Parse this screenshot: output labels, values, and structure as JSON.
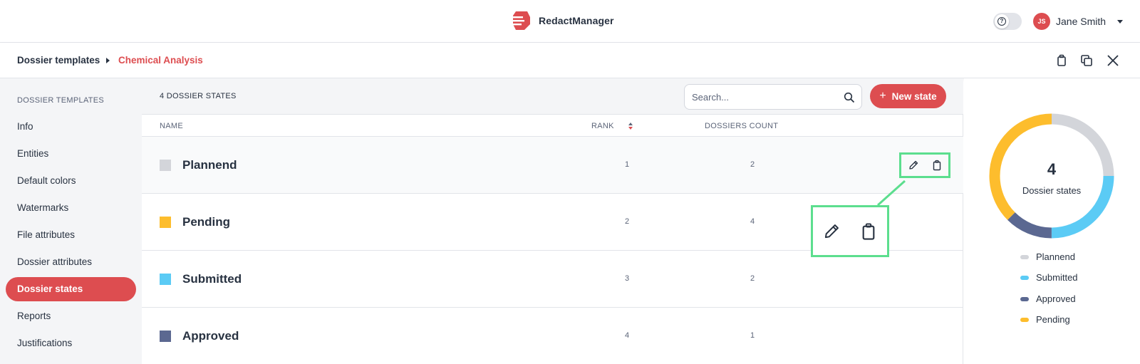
{
  "app": {
    "name": "RedactManager"
  },
  "user": {
    "initials": "JS",
    "name": "Jane Smith"
  },
  "breadcrumb": {
    "parent": "Dossier templates",
    "current": "Chemical Analysis"
  },
  "sidebar": {
    "heading": "DOSSIER TEMPLATES",
    "items": [
      {
        "label": "Info",
        "active": false
      },
      {
        "label": "Entities",
        "active": false
      },
      {
        "label": "Default colors",
        "active": false
      },
      {
        "label": "Watermarks",
        "active": false
      },
      {
        "label": "File attributes",
        "active": false
      },
      {
        "label": "Dossier attributes",
        "active": false
      },
      {
        "label": "Dossier states",
        "active": true
      },
      {
        "label": "Reports",
        "active": false
      },
      {
        "label": "Justifications",
        "active": false
      }
    ]
  },
  "main": {
    "count_label": "4 DOSSIER STATES",
    "search_placeholder": "Search...",
    "new_button": "New state",
    "columns": {
      "name": "NAME",
      "rank": "RANK",
      "count": "DOSSIERS COUNT"
    },
    "rows": [
      {
        "name": "Plannend",
        "rank": "1",
        "count": "2",
        "color": "#d3d5da"
      },
      {
        "name": "Pending",
        "rank": "2",
        "count": "4",
        "color": "#fdbd2d"
      },
      {
        "name": "Submitted",
        "rank": "3",
        "count": "2",
        "color": "#5bcbf5"
      },
      {
        "name": "Approved",
        "rank": "4",
        "count": "1",
        "color": "#5b6891"
      }
    ]
  },
  "summary": {
    "total": "4",
    "label": "Dossier states",
    "legend": [
      {
        "label": "Plannend",
        "color": "#d3d5da"
      },
      {
        "label": "Submitted",
        "color": "#5bcbf5"
      },
      {
        "label": "Approved",
        "color": "#5b6891"
      },
      {
        "label": "Pending",
        "color": "#fdbd2d"
      }
    ]
  },
  "colors": {
    "accent": "#dd4d50",
    "highlight": "#5cde8e"
  }
}
